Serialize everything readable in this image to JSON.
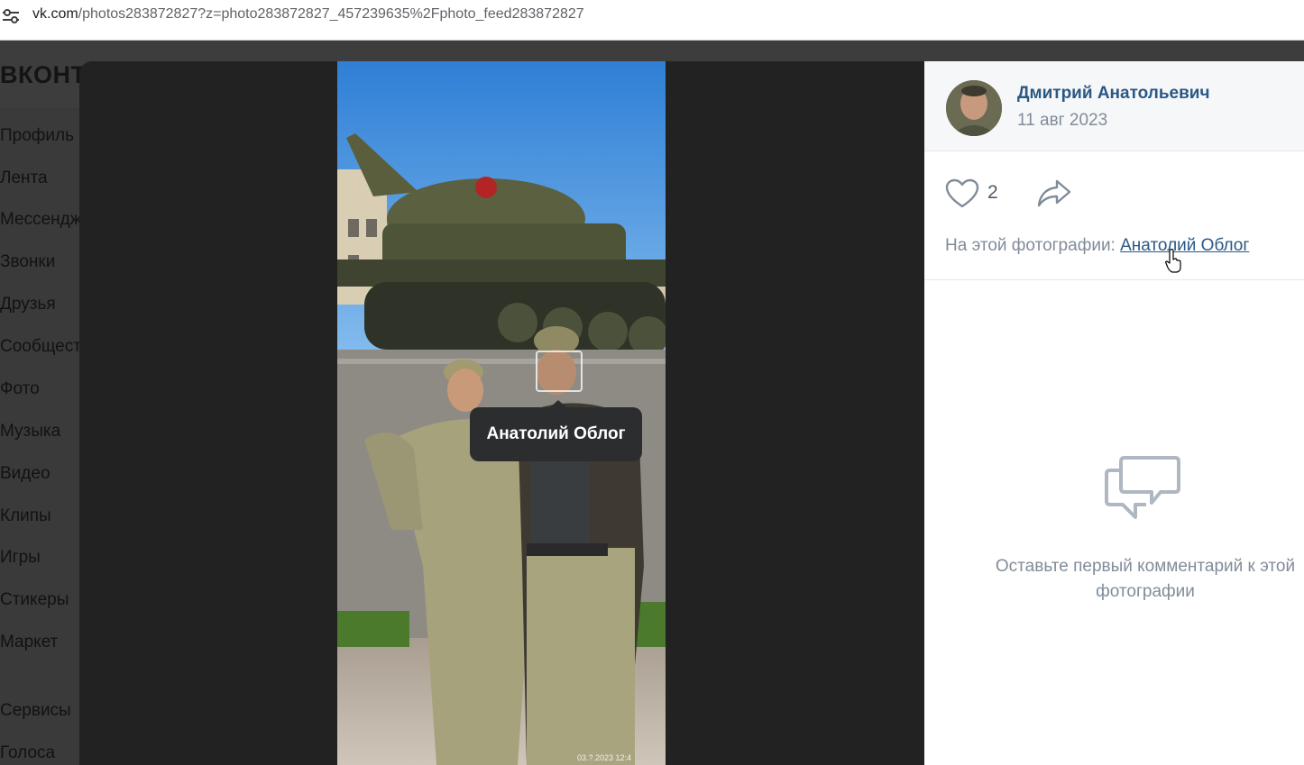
{
  "browser": {
    "url_host": "vk.com",
    "url_path": "/photos283872827?z=photo283872827_457239635%2Fphoto_feed283872827"
  },
  "vk": {
    "logo": "ВКОНТ",
    "menu": [
      {
        "label": "Профиль"
      },
      {
        "label": "Лента"
      },
      {
        "label": "Мессендж"
      },
      {
        "label": "Звонки"
      },
      {
        "label": "Друзья"
      },
      {
        "label": "Сообщест"
      },
      {
        "label": "Фото"
      },
      {
        "label": "Музыка"
      },
      {
        "label": "Видео"
      },
      {
        "label": "Клипы"
      },
      {
        "label": "Игры"
      },
      {
        "label": "Стикеры"
      },
      {
        "label": "Маркет"
      },
      {
        "label": "Сервисы"
      },
      {
        "label": "Голоса"
      }
    ]
  },
  "photo": {
    "tag_name": "Анатолий Облог",
    "timestamp": "03.?.2023 12:4"
  },
  "panel": {
    "author": "Дмитрий Анатольевич",
    "date": "11 авг 2023",
    "likes": "2",
    "on_photo_label": "На этой фотографии:",
    "on_photo_person": "Анатолий Облог",
    "empty_text": "Оставьте первый комментарий к этой фотографии"
  },
  "colors": {
    "link": "#2a5885",
    "secondary_text": "#818c99",
    "viewer_bg": "#222222"
  }
}
